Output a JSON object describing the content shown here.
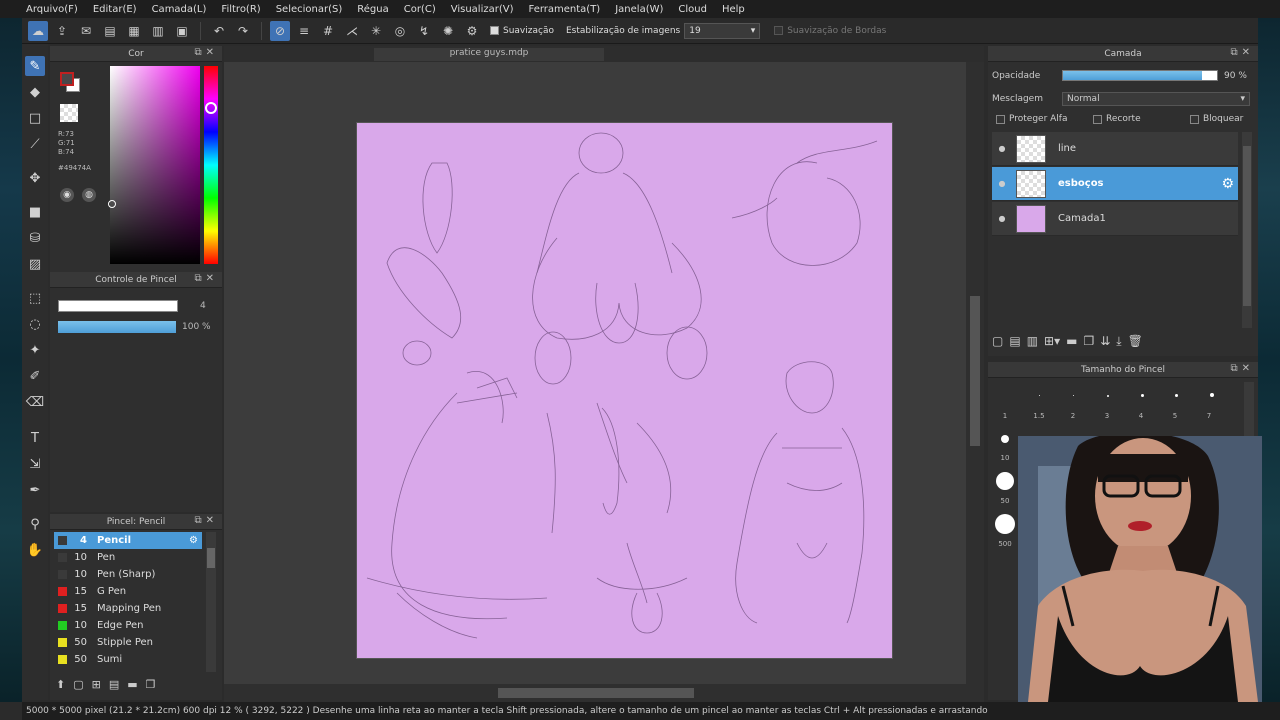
{
  "menubar": [
    "Arquivo(F)",
    "Editar(E)",
    "Camada(L)",
    "Filtro(R)",
    "Selecionar(S)",
    "Régua",
    "Cor(C)",
    "Visualizar(V)",
    "Ferramenta(T)",
    "Janela(W)",
    "Cloud",
    "Help"
  ],
  "toolbar": {
    "smoothing_label": "Suavização",
    "stabilization_label": "Estabilização de imagens",
    "stabilization_value": "19",
    "edge_smoothing_label": "Suavização de Bordas"
  },
  "color_panel": {
    "title": "Cor",
    "rgb": [
      "R:73",
      "G:71",
      "B:74"
    ],
    "hex": "#49474A",
    "fg_color": "#494749"
  },
  "brush_control": {
    "title": "Controle de Pincel",
    "size_value": "4",
    "opacity_value": "100 %"
  },
  "brush_list": {
    "title": "Pincel: Pencil",
    "items": [
      {
        "size": "4",
        "name": "Pencil",
        "color": "#3a3a3a",
        "selected": true
      },
      {
        "size": "10",
        "name": "Pen",
        "color": "#3a3a3a"
      },
      {
        "size": "10",
        "name": "Pen (Sharp)",
        "color": "#3a3a3a"
      },
      {
        "size": "15",
        "name": "G Pen",
        "color": "#e02020"
      },
      {
        "size": "15",
        "name": "Mapping Pen",
        "color": "#e02020"
      },
      {
        "size": "10",
        "name": "Edge Pen",
        "color": "#22cc22"
      },
      {
        "size": "50",
        "name": "Stipple Pen",
        "color": "#e8e020"
      },
      {
        "size": "50",
        "name": "Sumi",
        "color": "#e8e020"
      }
    ]
  },
  "document": {
    "tab_title": "pratice guys.mdp",
    "canvas_color": "#d9a8ea"
  },
  "layer_panel": {
    "title": "Camada",
    "opacity_label": "Opacidade",
    "opacity_value": "90 %",
    "opacity_fraction": 0.9,
    "blend_label": "Mesclagem",
    "blend_value": "Normal",
    "protect_alpha": "Proteger Alfa",
    "clipping": "Recorte",
    "lock": "Bloquear",
    "layers": [
      {
        "name": "line",
        "selected": false
      },
      {
        "name": "esboços",
        "selected": true
      },
      {
        "name": "Camada1",
        "selected": false
      }
    ]
  },
  "brush_size_panel": {
    "title": "Tamanho do Pincel",
    "sizes_row1": [
      "1",
      "1.5",
      "2",
      "3",
      "4",
      "5",
      "7"
    ],
    "sizes_col": [
      "10",
      "50",
      "500"
    ]
  },
  "status": {
    "text": "5000 * 5000 pixel   (21.2 * 21.2cm)   600 dpi   12 %   ( 3292, 5222 )   Desenhe uma linha reta ao manter a tecla Shift pressionada, altere o tamanho de um pincel ao manter as teclas Ctrl + Alt pressionadas e arrastando"
  }
}
